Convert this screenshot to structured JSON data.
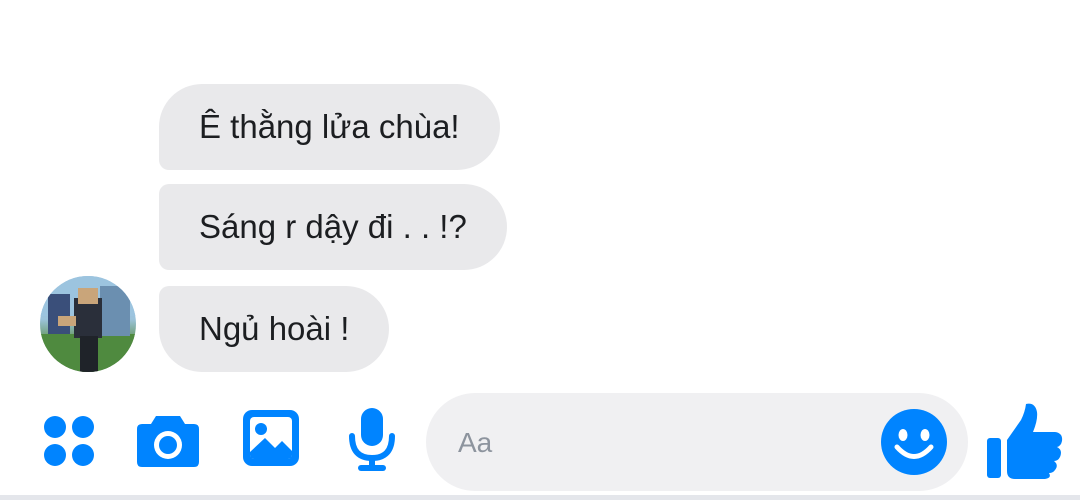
{
  "messages": [
    {
      "text": "Ê thằng lửa chùa!"
    },
    {
      "text": "Sáng r dậy đi . . !?"
    },
    {
      "text": "Ngủ hoài !"
    }
  ],
  "composer": {
    "placeholder": "Aa"
  },
  "colors": {
    "accent": "#0084ff",
    "bubble": "#e9e9eb",
    "input_bg": "#f0f0f2"
  },
  "icons": {
    "apps": "apps-icon",
    "camera": "camera-icon",
    "gallery": "image-icon",
    "mic": "microphone-icon",
    "emoji": "emoji-icon",
    "like": "thumbs-up-icon"
  }
}
